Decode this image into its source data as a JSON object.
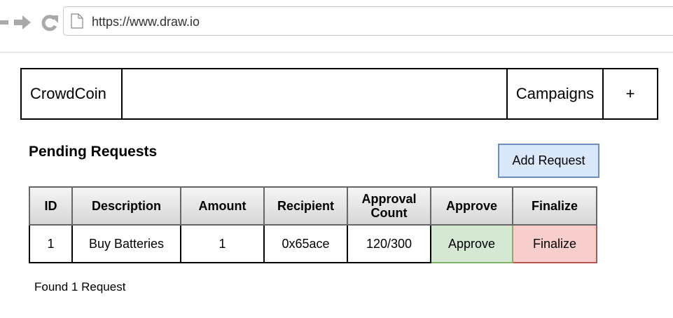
{
  "browser": {
    "url": "https://www.draw.io"
  },
  "header": {
    "brand": "CrowdCoin",
    "campaigns_label": "Campaigns",
    "add_label": "+"
  },
  "section": {
    "title": "Pending Requests",
    "add_request_label": "Add Request"
  },
  "table": {
    "columns": {
      "id": "ID",
      "description": "Description",
      "amount": "Amount",
      "recipient": "Recipient",
      "approval_count_line1": "Approval",
      "approval_count_line2": "Count",
      "approve": "Approve",
      "finalize": "Finalize"
    },
    "rows": [
      {
        "id": "1",
        "description": "Buy Batteries",
        "amount": "1",
        "recipient": "0x65ace",
        "approval_count": "120/300",
        "approve_label": "Approve",
        "finalize_label": "Finalize"
      }
    ]
  },
  "footer": {
    "found_text": "Found 1 Request"
  },
  "colors": {
    "add_request_fill": "#dae8fc",
    "approve_fill": "#d5e8d4",
    "finalize_fill": "#f8cecc"
  }
}
